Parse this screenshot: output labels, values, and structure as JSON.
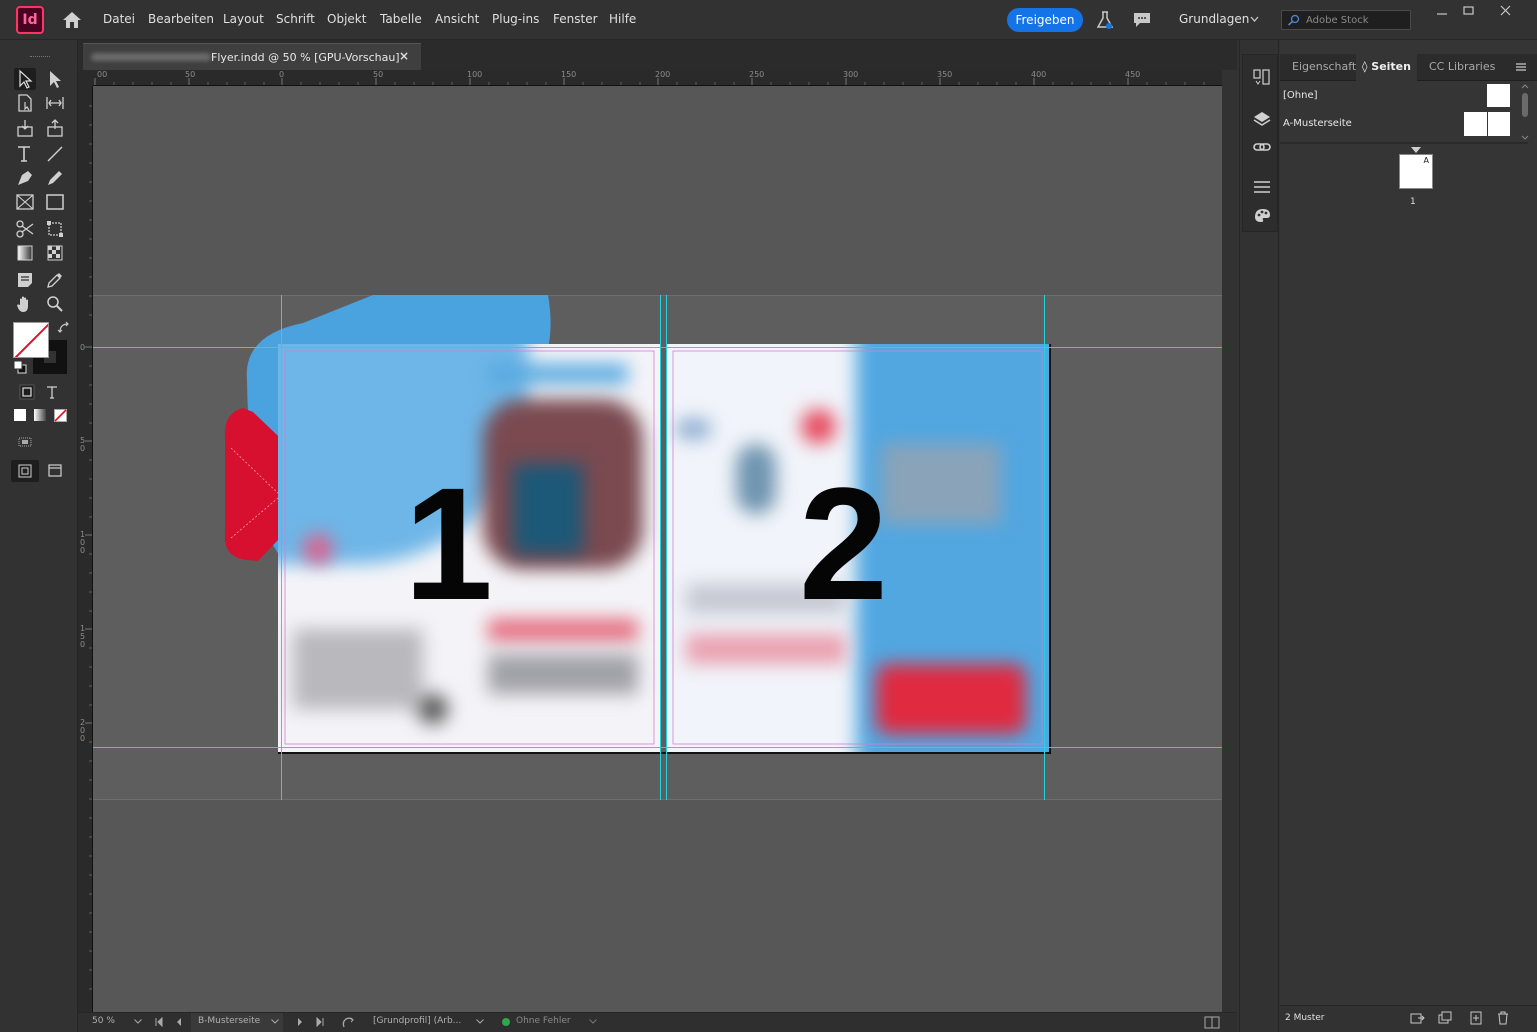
{
  "app": {
    "logo_text": "Id",
    "menu": [
      "Datei",
      "Bearbeiten",
      "Layout",
      "Schrift",
      "Objekt",
      "Tabelle",
      "Ansicht",
      "Plug-ins",
      "Fenster",
      "Hilfe"
    ],
    "share_label": "Freigeben",
    "workspace": "Grundlagen",
    "stock_placeholder": "Adobe Stock"
  },
  "document_tab": {
    "title": "Flyer.indd @ 50 % [GPU-Vorschau]",
    "close": "×"
  },
  "rulers": {
    "top": [
      "00",
      "50",
      "0",
      "50",
      "100",
      "150",
      "200",
      "250",
      "300",
      "350",
      "400",
      "450"
    ],
    "left": [
      "0",
      "5 0",
      "1 0 0",
      "1 5 0",
      "2 0 0"
    ]
  },
  "canvas": {
    "page_numbers": [
      "1",
      "2"
    ],
    "colors": {
      "guide": "#22d3e0",
      "blue": "#4aa3df",
      "red": "#d8102f"
    }
  },
  "pages_panel": {
    "tabs": [
      "Eigenschafte",
      "Seiten",
      "CC Libraries"
    ],
    "active_tab": "Seiten",
    "masters": [
      "[Ohne]",
      "A-Musterseite"
    ],
    "page_thumb_letter": "A",
    "page_thumb_number": "1",
    "footer_label": "2 Muster"
  },
  "statusbar": {
    "zoom": "50 %",
    "page_select": "B-Musterseite",
    "profile": "[Grundprofil] (Arb...",
    "preflight": "Ohne Fehler"
  }
}
